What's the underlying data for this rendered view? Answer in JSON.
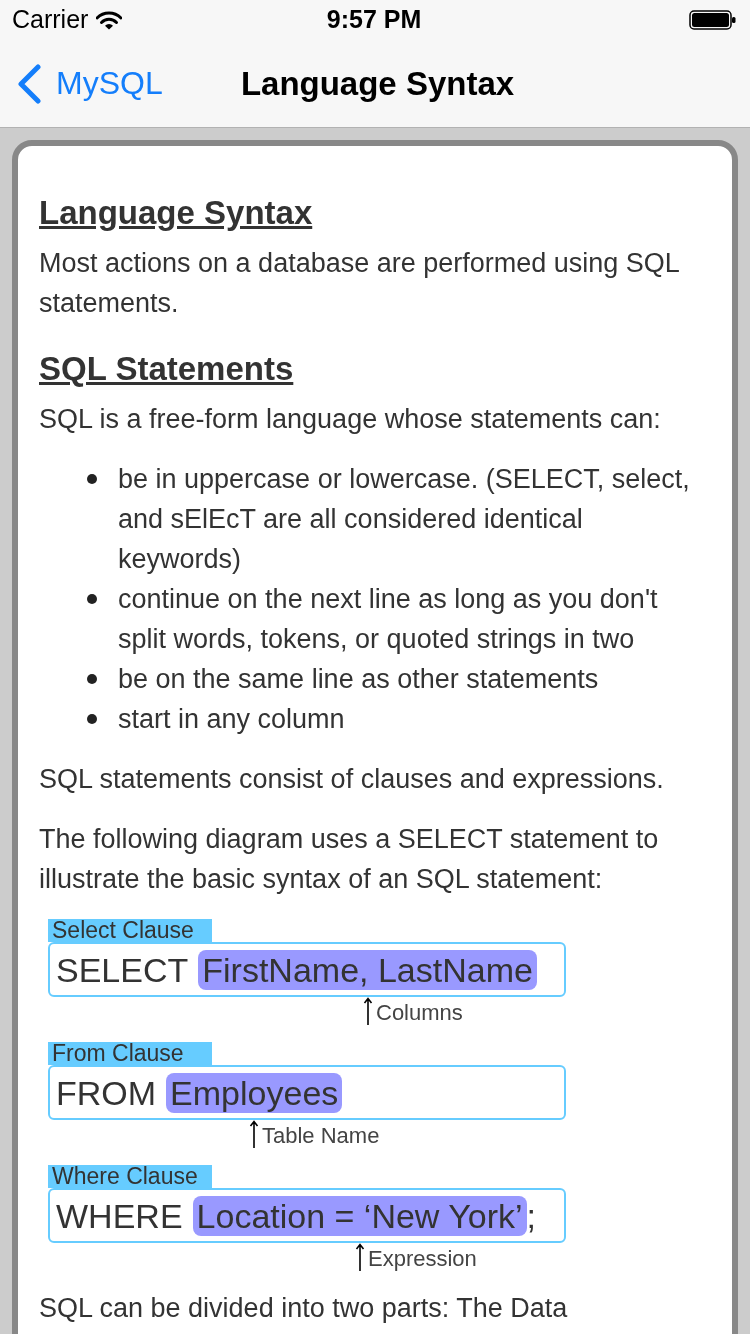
{
  "status_bar": {
    "carrier": "Carrier",
    "time": "9:57 PM"
  },
  "nav_bar": {
    "back_label": "MySQL",
    "title": "Language Syntax"
  },
  "content": [
    {
      "kind": "heading",
      "text": "Language Syntax"
    },
    {
      "kind": "paragraph",
      "text": "Most actions on a database are performed using SQL statements."
    },
    {
      "kind": "heading",
      "text": "SQL Statements"
    },
    {
      "kind": "paragraph",
      "text": "SQL is a free-form language whose statements can:"
    },
    {
      "kind": "list",
      "items": [
        "be in uppercase or lowercase. (SELECT, select, and sElEcT are all considered identical keywords)",
        "continue on the next line as long as you don't split words, tokens, or quoted strings in two",
        "be on the same line as other statements",
        "start in any column"
      ]
    },
    {
      "kind": "paragraph",
      "text": "SQL statements consist of clauses and expressions."
    },
    {
      "kind": "paragraph",
      "text": "The following diagram uses a SELECT statement to illustrate the basic syntax of an SQL statement:"
    },
    {
      "kind": "diagram",
      "clauses": [
        {
          "label": "Select Clause",
          "keyword": "SELECT",
          "highlight": "FirstName, LastName",
          "note": "Columns"
        },
        {
          "label": "From Clause",
          "keyword": "FROM",
          "highlight": "Employees",
          "note": "Table Name"
        },
        {
          "label": "Where Clause",
          "keyword": "WHERE",
          "highlight": "Location = ‘New York’",
          "suffix": ";",
          "note": "Expression"
        }
      ]
    },
    {
      "kind": "paragraph",
      "text": "SQL can be divided into two parts: The Data"
    }
  ]
}
